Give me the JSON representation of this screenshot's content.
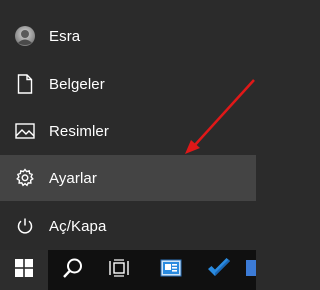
{
  "start_menu": {
    "items": [
      {
        "label": "Esra",
        "icon": "user-avatar"
      },
      {
        "label": "Belgeler",
        "icon": "document-icon"
      },
      {
        "label": "Resimler",
        "icon": "picture-icon"
      },
      {
        "label": "Ayarlar",
        "icon": "gear-icon",
        "highlighted": true
      },
      {
        "label": "Aç/Kapa",
        "icon": "power-icon"
      }
    ]
  },
  "taskbar": {
    "buttons": [
      {
        "icon": "windows-logo-icon"
      },
      {
        "icon": "search-icon"
      },
      {
        "icon": "task-view-icon"
      },
      {
        "icon": "outlook-app-icon"
      },
      {
        "icon": "todo-check-icon"
      },
      {
        "icon": "app-icon"
      }
    ]
  },
  "colors": {
    "menu_bg": "#2b2b2b",
    "hover_bg": "#444444",
    "taskbar_bg": "#101010",
    "arrow": "#e01818",
    "accent_blue": "#2a8be0"
  }
}
